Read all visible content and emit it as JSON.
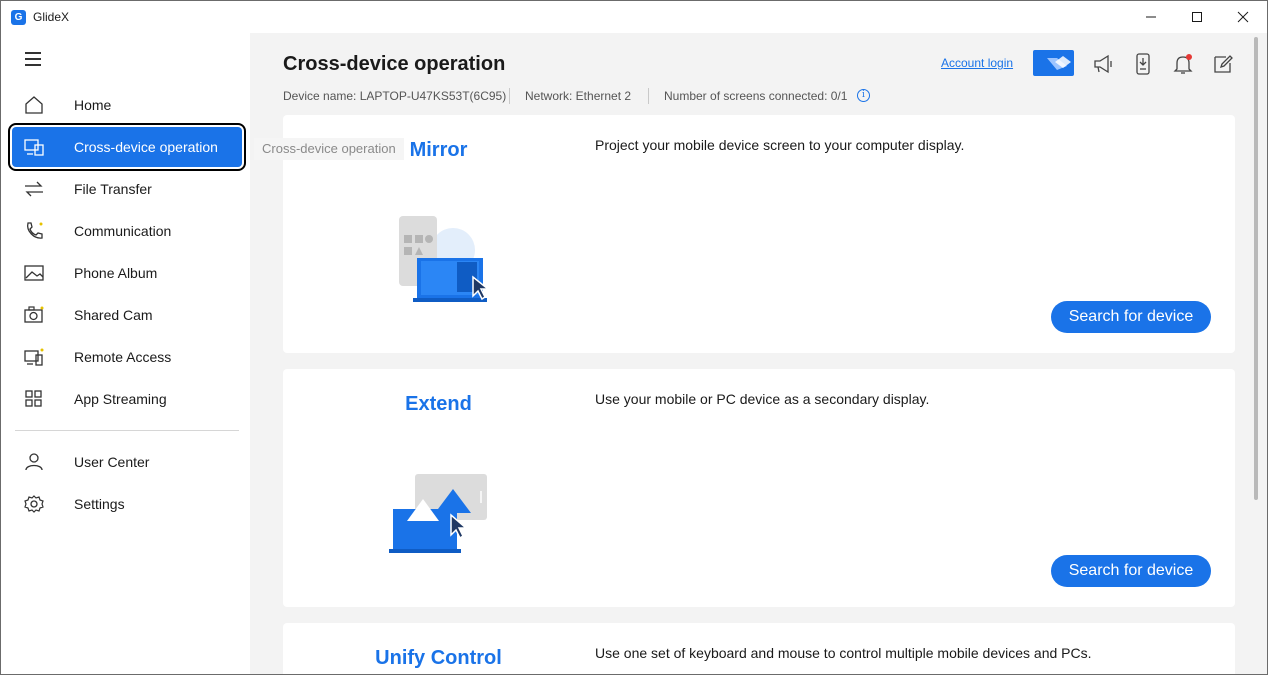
{
  "window": {
    "title": "GlideX",
    "logo_glyph": "G"
  },
  "sidebar": {
    "items": [
      {
        "label": "Home",
        "icon": "home-icon"
      },
      {
        "label": "Cross-device operation",
        "icon": "cross-device-icon",
        "active": true
      },
      {
        "label": "File Transfer",
        "icon": "file-transfer-icon"
      },
      {
        "label": "Communication",
        "icon": "phone-icon"
      },
      {
        "label": "Phone Album",
        "icon": "image-icon"
      },
      {
        "label": "Shared Cam",
        "icon": "camera-icon"
      },
      {
        "label": "Remote Access",
        "icon": "remote-access-icon"
      },
      {
        "label": "App Streaming",
        "icon": "apps-grid-icon"
      }
    ],
    "bottom_items": [
      {
        "label": "User Center",
        "icon": "user-icon"
      },
      {
        "label": "Settings",
        "icon": "gear-icon"
      }
    ],
    "tooltip": "Cross-device operation"
  },
  "header": {
    "title": "Cross-device operation",
    "device_name": "Device name: LAPTOP-U47KS53T(6C95)",
    "network": "Network: Ethernet 2",
    "screens_connected": "Number of screens connected: 0/1",
    "info_glyph": "i",
    "account_login": "Account login"
  },
  "cards": [
    {
      "title": "Mirror",
      "description": "Project your mobile device screen to your computer display.",
      "button": "Search for device"
    },
    {
      "title": "Extend",
      "description": "Use your mobile or PC device as a secondary display.",
      "button": "Search for device"
    },
    {
      "title": "Unify Control",
      "description": "Use one set of keyboard and mouse to control multiple mobile devices and PCs."
    }
  ],
  "colors": {
    "accent": "#1a73e8",
    "background": "#f3f3f3",
    "card": "#ffffff"
  }
}
